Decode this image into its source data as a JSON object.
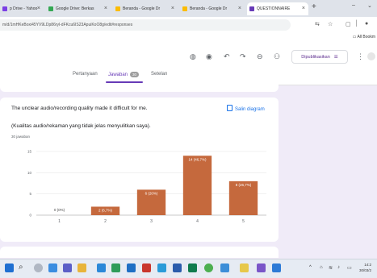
{
  "browser": {
    "tabs": [
      {
        "label": "p Drive - Yahoo",
        "color": "#7b3fe4"
      },
      {
        "label": "Google Drive: Berkas",
        "color": "#34a853"
      },
      {
        "label": "Beranda - Google Dr",
        "color": "#fbbc04"
      },
      {
        "label": "Beranda - Google Dr",
        "color": "#fbbc04"
      },
      {
        "label": "QUESTIONNAIRE",
        "color": "#673ab7"
      }
    ],
    "new_tab": "+",
    "url": "m/d/1mHKeBoxi45YV9LDp86ryl-dFKcu6IS23ApuiKoO8g/edit#responses",
    "bookmarks_all": "All Bookm"
  },
  "forms": {
    "publish_label": "Dipublikasikan",
    "tabs": {
      "questions": "Pertanyaan",
      "responses": "Jawaban",
      "responses_count": "30",
      "settings": "Setelan"
    }
  },
  "question": {
    "title": "The unclear audio/recording quality made it difficult for me.",
    "subtitle": "(Kualitas audio/rekaman yang tidak jelas menyulitkan saya).",
    "response_count": "30 jawaban",
    "copy_label": "Salin diagram"
  },
  "chart_data": {
    "type": "bar",
    "categories": [
      "1",
      "2",
      "3",
      "4",
      "5"
    ],
    "values": [
      0,
      2,
      6,
      14,
      8
    ],
    "data_labels": [
      "0 (0%)",
      "2 (6,7%)",
      "6 (20%)",
      "14 (46,7%)",
      "8 (26,7%)"
    ],
    "yticks": [
      "0",
      "5",
      "10",
      "15"
    ],
    "ylim": [
      0,
      15
    ],
    "bar_color": "#c5693d",
    "grid": true
  },
  "taskbar": {
    "time": "14:2",
    "date": "30/03/2"
  }
}
